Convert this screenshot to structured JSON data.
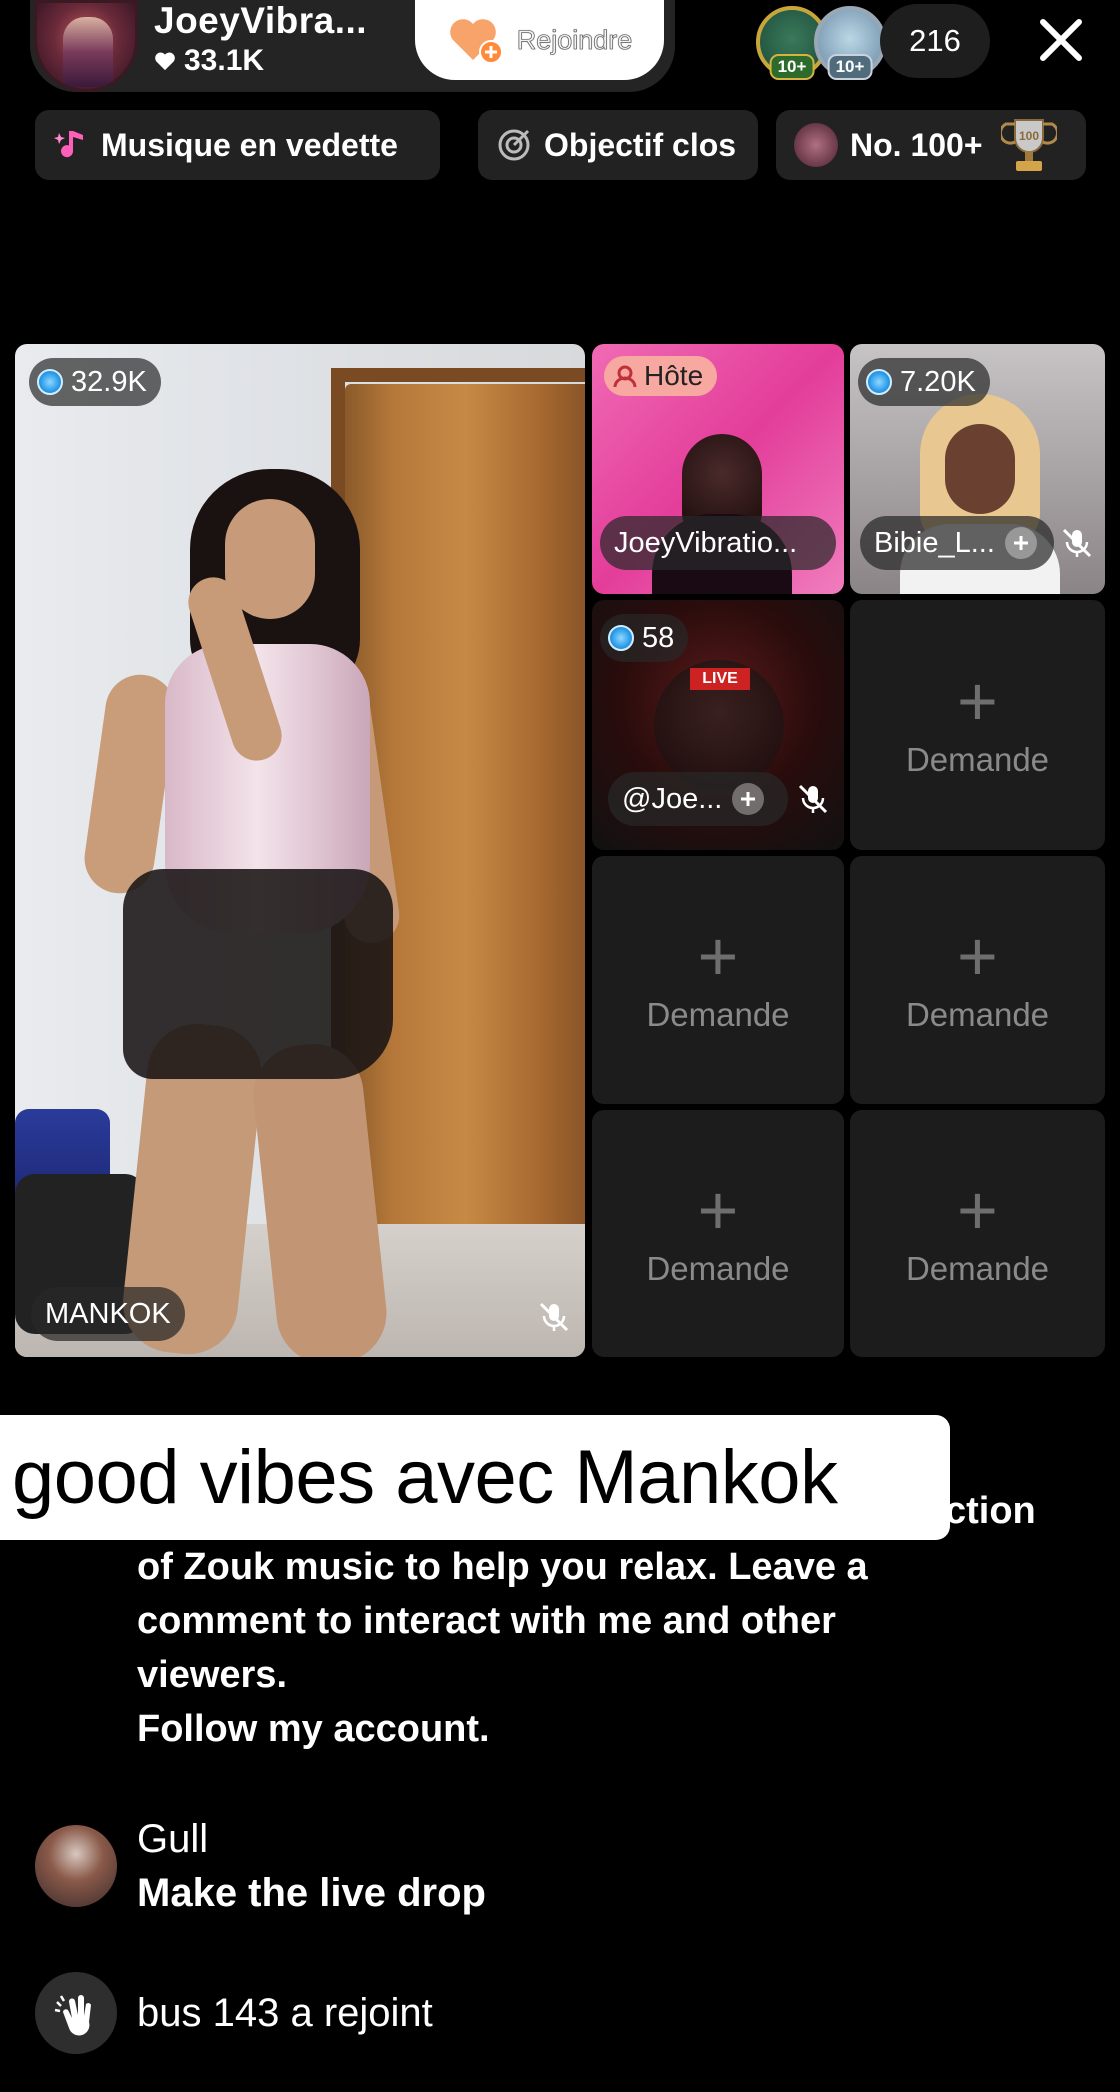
{
  "header": {
    "host_name": "JoeyVibra...",
    "likes": "33.1K",
    "join_label": "Rejoindre",
    "viewer_badges": [
      "10+",
      "10+"
    ],
    "viewer_count": "216"
  },
  "chips": {
    "music_label": "Musique en vedette",
    "goal_label": "Objectif clos",
    "rank_label": "No. 100+"
  },
  "grid": {
    "main": {
      "score": "32.9K",
      "name": "MANKOK"
    },
    "host": {
      "badge": "Hôte",
      "name": "JoeyVibratio..."
    },
    "guest2": {
      "score": "7.20K",
      "name": "Bibie_L..."
    },
    "guest3": {
      "score": "58",
      "name": "@Joe..."
    },
    "request_label": "Demande"
  },
  "caption": "good vibes avec Mankok",
  "description": {
    "tail": "ction",
    "text": "of Zouk music to help you relax. Leave a\ncomment to interact with me and other\nviewers.\nFollow my account."
  },
  "comments": [
    {
      "user": "Gull",
      "message": "Make the live drop"
    },
    {
      "message": "bus 143 a rejoint"
    }
  ],
  "colors": {
    "accent_pink": "#e33d9a",
    "gem_blue": "#2a9ae8",
    "background": "#000000"
  }
}
